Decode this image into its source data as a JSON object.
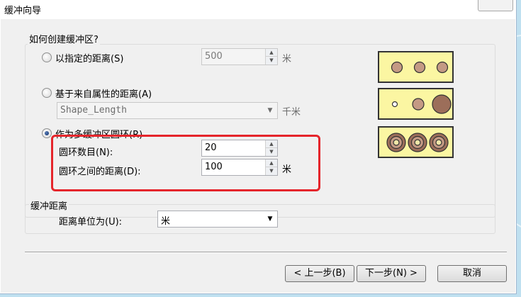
{
  "window": {
    "title": "缓冲向导"
  },
  "group1": {
    "legend": "如何创建缓冲区?",
    "option_distance": {
      "label": "以指定的距离(S)",
      "value": "500",
      "unit": "米",
      "selected": false
    },
    "option_attribute": {
      "label": "基于来自属性的距离(A)",
      "field": "Shape_Length",
      "unit": "千米",
      "selected": false
    },
    "option_rings": {
      "label": "作为多缓冲区圆环(R)",
      "selected": true,
      "ring_count_label": "圆环数目(N):",
      "ring_count_value": "20",
      "ring_distance_label": "圆环之间的距离(D):",
      "ring_distance_value": "100",
      "ring_distance_unit": "米"
    }
  },
  "group2": {
    "legend": "缓冲距离",
    "unit_label": "距离单位为(U):",
    "unit_value": "米"
  },
  "buttons": {
    "back": "< 上一步(B)",
    "next": "下一步(N) >",
    "cancel": "取消"
  },
  "colors": {
    "highlight_box": "#e5252b",
    "preview_fill": "#fbf6a2",
    "circle_fill": "#c49a84",
    "circle_large_fill": "#9c6e5a"
  },
  "icons": {
    "spin_up": "▲",
    "spin_down": "▼",
    "dropdown": "▼"
  }
}
